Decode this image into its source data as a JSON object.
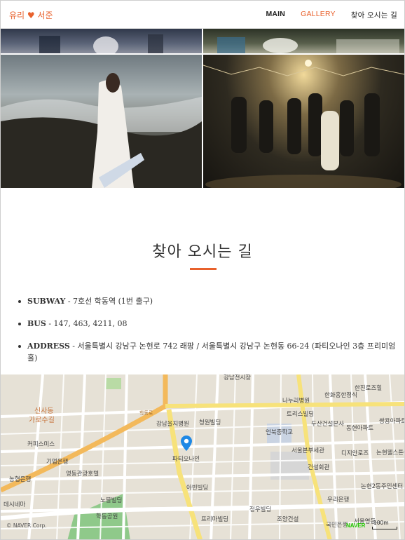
{
  "nav": {
    "brand": "유리 ♥ 서준",
    "items": [
      {
        "label": "MAIN"
      },
      {
        "label": "GALLERY"
      },
      {
        "label": "찾아 오시는 길"
      }
    ]
  },
  "directions": {
    "title": "찾아 오시는 길",
    "items": [
      {
        "label": "SUBWAY",
        "text": " - 7호선 학동역 (1번 출구)"
      },
      {
        "label": "BUS",
        "text": " - 147, 463, 4211, 08"
      },
      {
        "label": "ADDRESS",
        "text": " - 서울특별시 강남구 논현로 742 래팡 / 서울특별시 강남구 논현동 66-24 (파티오나인 3층 프리미엄홀)"
      }
    ]
  },
  "map": {
    "labels": [
      "강남전시장",
      "한화흥한정식",
      "한진로즈힐",
      "나누리병원",
      "트리스빌딩",
      "신사동",
      "가로수길",
      "강남을지병원",
      "청원빌딩",
      "언북중학교",
      "두산건설본사",
      "동현아파트",
      "쌍용아파트",
      "커피스미스",
      "기업은행",
      "파티오나인",
      "서울본부세관",
      "디지안로즈",
      "논현웰스톤아파트",
      "영동관광호텔",
      "건설회관",
      "논현2동주민센터",
      "농협은행",
      "아빈빌딩",
      "우리은행",
      "데시네마",
      "노블빌딩",
      "학동공원",
      "정우빌딩",
      "프리마빌딩",
      "조양건설",
      "국민은행",
      "서울영동..",
      "학동로"
    ],
    "copyright": "© NAVER Corp.",
    "logo": "NAVER",
    "scale": "100m",
    "pin_icon": "map-pin-icon"
  },
  "colors": {
    "accent": "#e8612c",
    "pin": "#1e88e5"
  }
}
